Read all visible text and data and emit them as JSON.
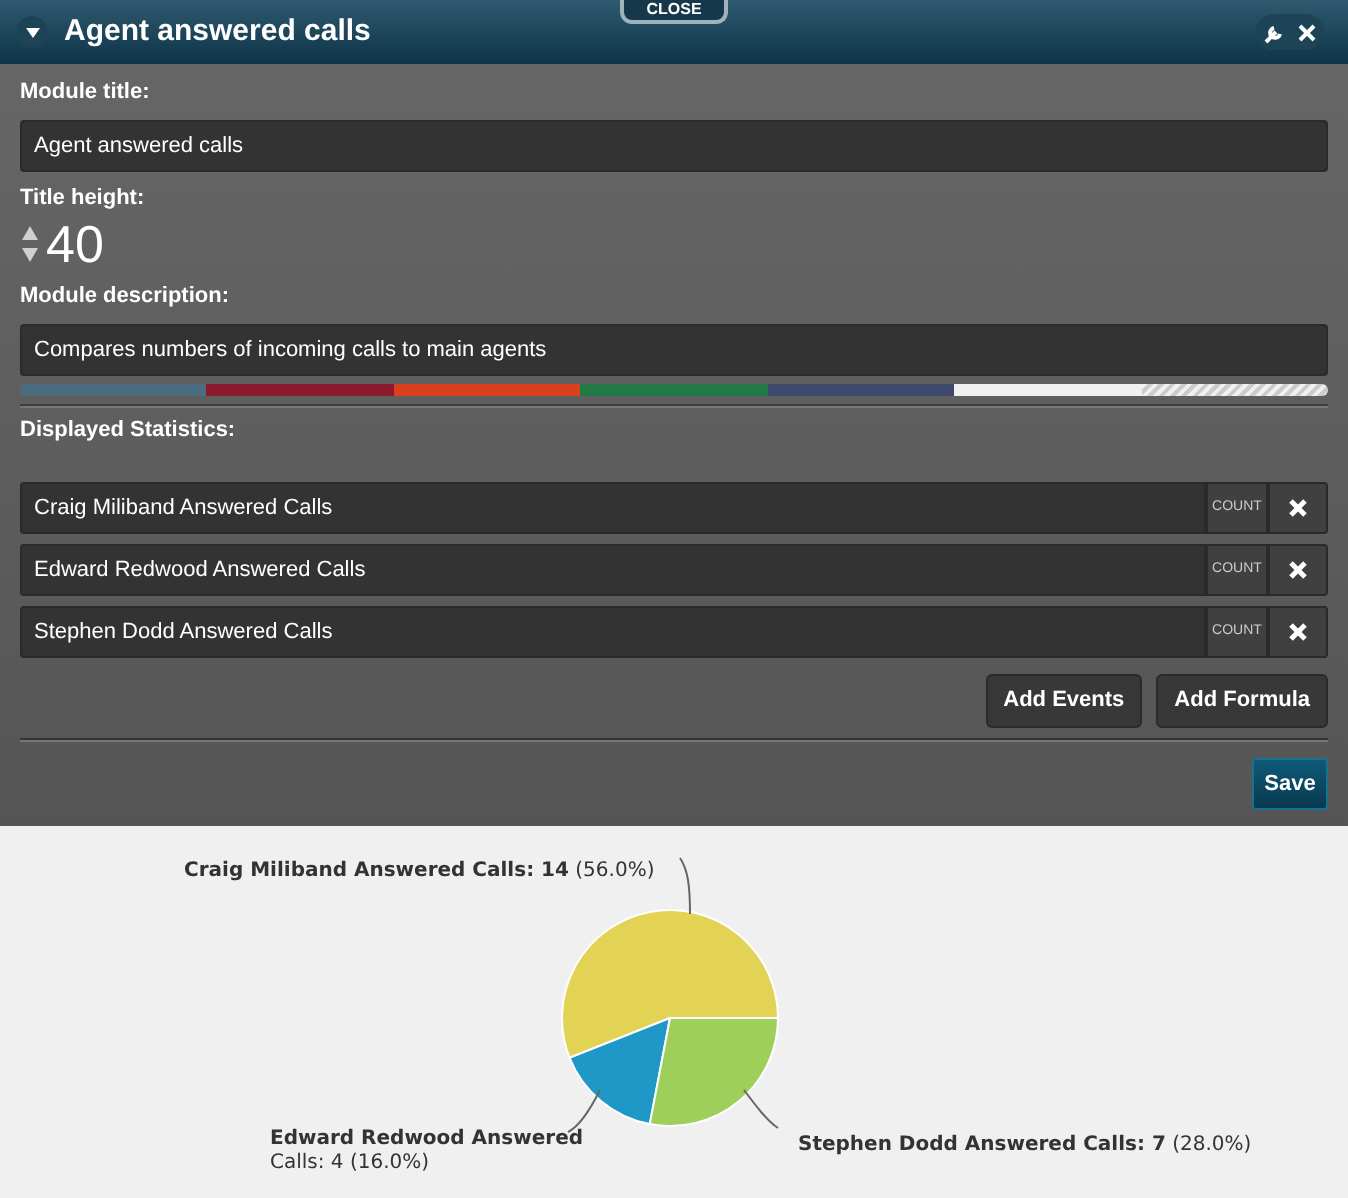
{
  "window": {
    "title": "Agent answered calls",
    "close_tab": "CLOSE"
  },
  "form": {
    "module_title_label": "Module title:",
    "module_title_value": "Agent answered calls",
    "title_height_label": "Title height:",
    "title_height_value": "40",
    "description_label": "Module description:",
    "description_value": "Compares numbers of incoming calls to main agents",
    "colors": [
      {
        "kind": "solid",
        "color": "#4a6b80"
      },
      {
        "kind": "solid",
        "color": "#8b1a2e"
      },
      {
        "kind": "solid",
        "color": "#d9401f"
      },
      {
        "kind": "solid",
        "color": "#217a45"
      },
      {
        "kind": "solid",
        "color": "#3d4a6e"
      },
      {
        "kind": "solid",
        "color": "#f0f0f0"
      },
      {
        "kind": "none",
        "color": "#f0f0f0"
      }
    ],
    "statistics_label": "Displayed Statistics:",
    "statistics": [
      {
        "name": "Craig Miliband Answered Calls",
        "type": "COUNT"
      },
      {
        "name": "Edward Redwood Answered Calls",
        "type": "COUNT"
      },
      {
        "name": "Stephen Dodd Answered Calls",
        "type": "COUNT"
      }
    ],
    "buttons": [
      "Add Events",
      "Add Formula"
    ],
    "save": "Save"
  },
  "chart": {
    "chart_data": {
      "type": "pie",
      "values": [
        14,
        4,
        7
      ],
      "colors": [
        "#e3d355",
        "#1f98c7",
        "#9ecf5a"
      ],
      "value_labels": [
        "**Craig Miliband Answered Calls: 14** (56.0%)",
        "**Edward Redwood Answered** Calls: 4 (16.0%)",
        "**Stephen Dodd Answered Calls: 7** (28.0%)"
      ]
    }
  }
}
